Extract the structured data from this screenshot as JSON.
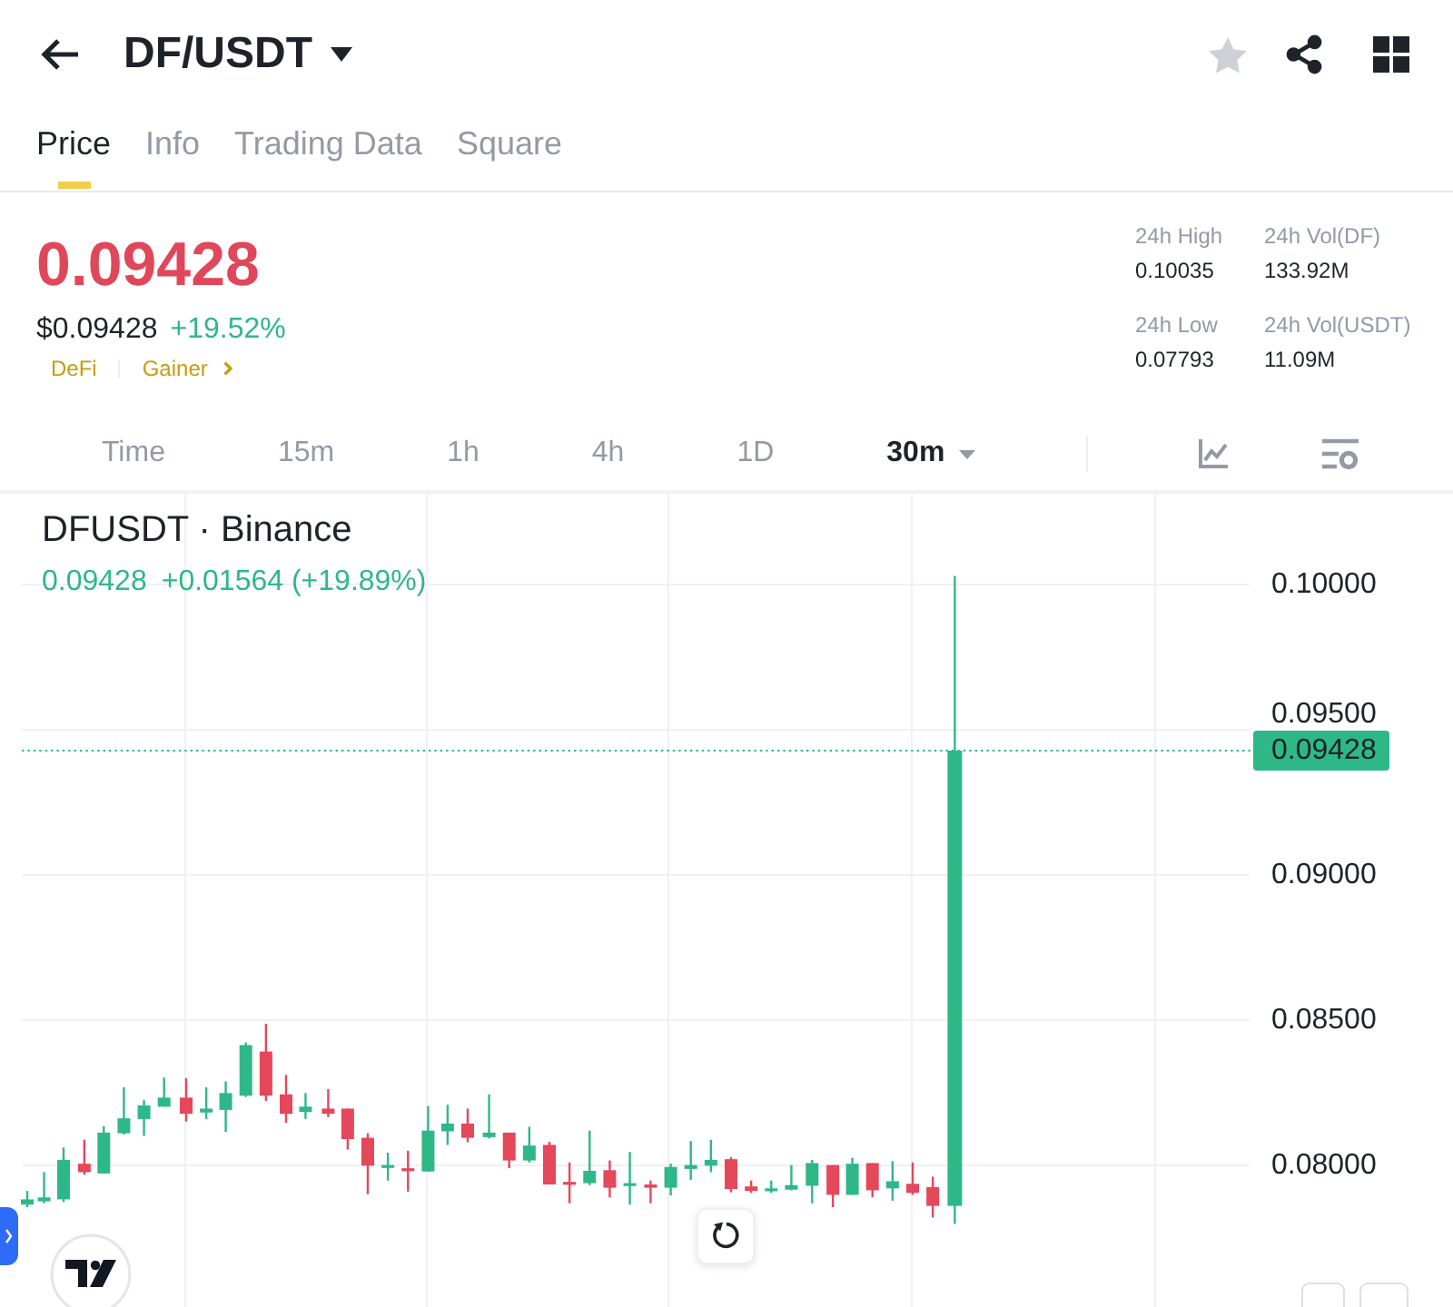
{
  "header": {
    "title": "DF/USDT",
    "favorite": false
  },
  "tabs": [
    {
      "label": "Price",
      "selected": true
    },
    {
      "label": "Info",
      "selected": false
    },
    {
      "label": "Trading Data",
      "selected": false
    },
    {
      "label": "Square",
      "selected": false
    }
  ],
  "price": {
    "last": "0.09428",
    "falling": true,
    "usd": "$0.09428",
    "change": "+19.52%",
    "tags": [
      {
        "label": "DeFi",
        "arrow": false
      },
      {
        "label": "Gainer",
        "arrow": true
      }
    ]
  },
  "stats": [
    {
      "label": "24h High",
      "value": "0.10035"
    },
    {
      "label": "24h Vol(DF)",
      "value": "133.92M"
    },
    {
      "label": "24h Low",
      "value": "0.07793"
    },
    {
      "label": "24h Vol(USDT)",
      "value": "11.09M"
    }
  ],
  "intervals": [
    {
      "label": "Time",
      "selected": false,
      "dropdown": false
    },
    {
      "label": "15m",
      "selected": false,
      "dropdown": false
    },
    {
      "label": "1h",
      "selected": false,
      "dropdown": false
    },
    {
      "label": "4h",
      "selected": false,
      "dropdown": false
    },
    {
      "label": "1D",
      "selected": false,
      "dropdown": false
    },
    {
      "label": "30m",
      "selected": true,
      "dropdown": true
    }
  ],
  "chart": {
    "symbol": "DFUSDT · Binance",
    "last": "0.09428",
    "change": "+0.01564 (+19.89%)",
    "price_axis": [
      "0.10000",
      "0.09500",
      "0.09000",
      "0.08500",
      "0.08000"
    ],
    "last_price_tag": "0.09428"
  }
}
